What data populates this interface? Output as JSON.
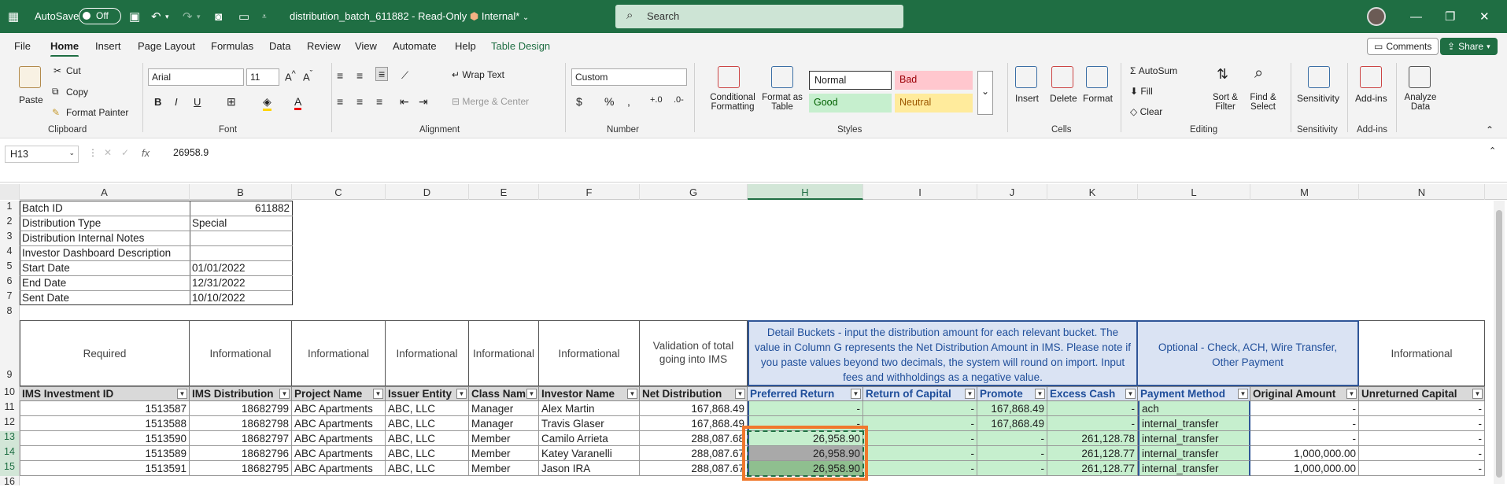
{
  "titlebar": {
    "autosave": "AutoSave",
    "toggle": "Off",
    "title": "distribution_batch_611882 - Read-Only",
    "label": "Internal*",
    "search": "Search"
  },
  "menu": {
    "tabs": [
      "File",
      "Home",
      "Insert",
      "Page Layout",
      "Formulas",
      "Data",
      "Review",
      "View",
      "Automate",
      "Help",
      "Table Design"
    ],
    "comments": "Comments",
    "share": "Share"
  },
  "ribbon": {
    "clipboard": {
      "paste": "Paste",
      "cut": "Cut",
      "copy": "Copy",
      "format_painter": "Format Painter",
      "label": "Clipboard"
    },
    "font": {
      "name": "Arial",
      "size": "11",
      "label": "Font"
    },
    "alignment": {
      "wrap": "Wrap Text",
      "merge": "Merge & Center",
      "label": "Alignment"
    },
    "number": {
      "format": "Custom",
      "label": "Number"
    },
    "styles": {
      "cond": "Conditional Formatting",
      "fmt_table": "Format as Table",
      "normal": "Normal",
      "bad": "Bad",
      "good": "Good",
      "neutral": "Neutral",
      "label": "Styles"
    },
    "cells": {
      "insert": "Insert",
      "delete": "Delete",
      "format": "Format",
      "label": "Cells"
    },
    "editing": {
      "autosum": "AutoSum",
      "fill": "Fill",
      "clear": "Clear",
      "sort": "Sort & Filter",
      "find": "Find & Select",
      "label": "Editing"
    },
    "sensitivity": {
      "btn": "Sensitivity",
      "label": "Sensitivity"
    },
    "addins": {
      "btn": "Add-ins",
      "label": "Add-ins"
    },
    "analyze": {
      "btn": "Analyze Data"
    }
  },
  "formula": {
    "cell": "H13",
    "value": "26958.9",
    "fx": "fx"
  },
  "columns": [
    "A",
    "B",
    "C",
    "D",
    "E",
    "F",
    "G",
    "H",
    "I",
    "J",
    "K",
    "L",
    "M",
    "N"
  ],
  "rows": [
    "1",
    "2",
    "3",
    "4",
    "5",
    "6",
    "7",
    "8",
    "9",
    "10",
    "11",
    "12",
    "13",
    "14",
    "15",
    "16"
  ],
  "meta": [
    {
      "label": "Batch ID",
      "value": "611882"
    },
    {
      "label": "Distribution Type",
      "value": "Special"
    },
    {
      "label": "Distribution Internal Notes",
      "value": ""
    },
    {
      "label": "Investor Dashboard Description",
      "value": ""
    },
    {
      "label": "Start Date",
      "value": "01/01/2022"
    },
    {
      "label": "End Date",
      "value": "12/31/2022"
    },
    {
      "label": "Sent Date",
      "value": "10/10/2022"
    }
  ],
  "row9": {
    "a": "Required",
    "b": "Informational",
    "c": "Informational",
    "d": "Informational",
    "e": "Informational",
    "f": "Informational",
    "g": "Validation of total going into IMS",
    "hk": "Detail Buckets - input the distribution amount for each relevant bucket. The value in Column G represents the Net Distribution Amount in IMS. Please note if you paste values beyond two decimals, the system will round on import. Input fees and withholdings as a negative value.",
    "l": "Optional - Check, ACH, Wire Transfer, Other Payment",
    "mn": "Informational"
  },
  "headers": [
    "IMS Investment ID",
    "IMS Distribution",
    "Project Name",
    "Issuer Entity",
    "Class Nam",
    "Investor Name",
    "Net Distribution",
    "Preferred Return",
    "Return of Capital",
    "Promote",
    "Excess Cash",
    "Payment Method",
    "Original Amount",
    "Unreturned Capital"
  ],
  "table": [
    [
      "1513587",
      "18682799",
      "ABC Apartments",
      "ABC, LLC",
      "Manager",
      "Alex Martin",
      "167,868.49",
      "-",
      "-",
      "167,868.49",
      "-",
      "ach",
      "-",
      "-"
    ],
    [
      "1513588",
      "18682798",
      "ABC Apartments",
      "ABC, LLC",
      "Manager",
      "Travis Glaser",
      "167,868.49",
      "-",
      "-",
      "167,868.49",
      "-",
      "internal_transfer",
      "-",
      "-"
    ],
    [
      "1513590",
      "18682797",
      "ABC Apartments",
      "ABC, LLC",
      "Member",
      "Camilo Arrieta",
      "288,087.68",
      "26,958.90",
      "-",
      "-",
      "261,128.78",
      "internal_transfer",
      "-",
      "-"
    ],
    [
      "1513589",
      "18682796",
      "ABC Apartments",
      "ABC, LLC",
      "Member",
      "Katey Varanelli",
      "288,087.67",
      "26,958.90",
      "-",
      "-",
      "261,128.77",
      "internal_transfer",
      "1,000,000.00",
      "-"
    ],
    [
      "1513591",
      "18682795",
      "ABC Apartments",
      "ABC, LLC",
      "Member",
      "Jason IRA",
      "288,087.67",
      "26,958.90",
      "-",
      "-",
      "261,128.77",
      "internal_transfer",
      "1,000,000.00",
      "-"
    ]
  ]
}
